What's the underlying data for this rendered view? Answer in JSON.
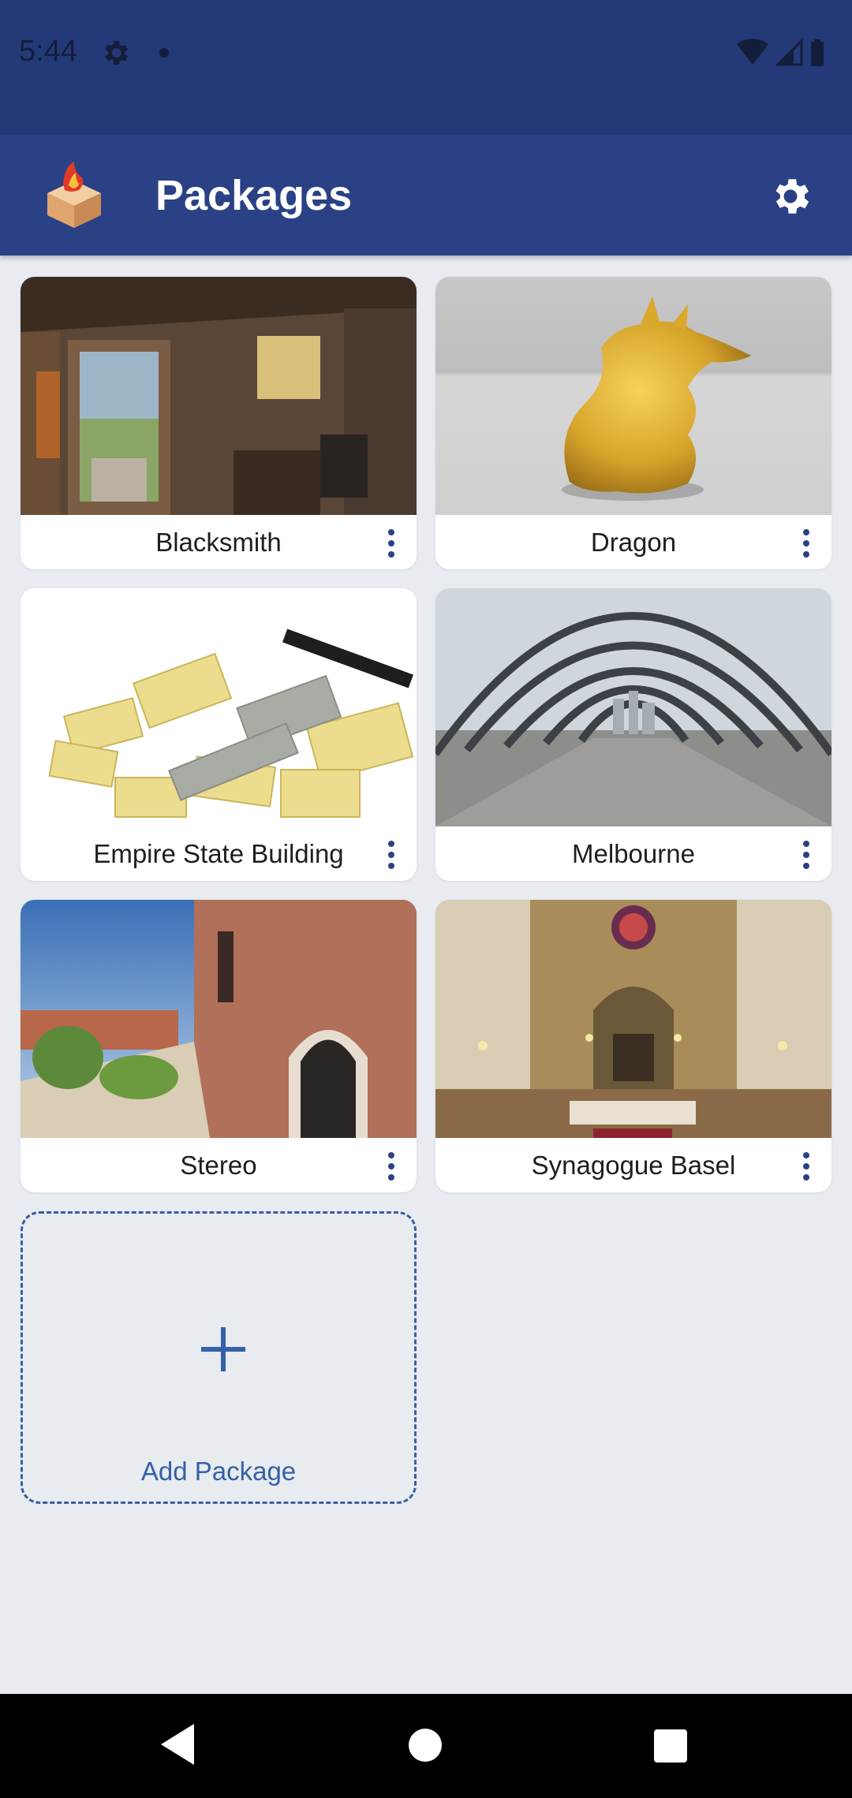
{
  "status_bar": {
    "time": "5:44",
    "icons": [
      "gear-icon",
      "dot-icon",
      "wifi-icon",
      "signal-icon",
      "battery-icon"
    ]
  },
  "app_bar": {
    "title": "Packages",
    "logo": "package-box-logo",
    "settings_icon": "gear-icon",
    "background": "#2a4185"
  },
  "packages": [
    {
      "name": "Blacksmith",
      "menu_icon": "more-vert-icon"
    },
    {
      "name": "Dragon",
      "menu_icon": "more-vert-icon"
    },
    {
      "name": "Empire State Building",
      "menu_icon": "more-vert-icon"
    },
    {
      "name": "Melbourne",
      "menu_icon": "more-vert-icon"
    },
    {
      "name": "Stereo",
      "menu_icon": "more-vert-icon"
    },
    {
      "name": "Synagogue Basel",
      "menu_icon": "more-vert-icon"
    }
  ],
  "add_package": {
    "label": "Add Package",
    "icon": "plus-icon"
  },
  "nav_bar": {
    "buttons": [
      "back-icon",
      "home-icon",
      "recents-icon"
    ]
  },
  "colors": {
    "status_bar": "#233978",
    "app_bar": "#2a4185",
    "background": "#e8ebf0",
    "accent": "#3461a8"
  }
}
